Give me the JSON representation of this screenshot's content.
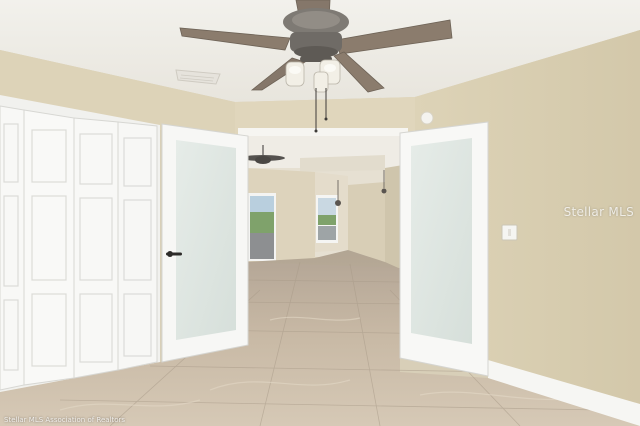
{
  "photo": {
    "subject": "empty bedroom with bifold closet doors, open frosted-glass french doors and a ceiling fan",
    "watermark_logo": "Stellar MLS",
    "watermark_credit": "Stellar MLS Association of Realtors"
  },
  "colors": {
    "wall": "#ddd3b8",
    "ceiling": "#f1efea",
    "trim": "#f7f7f4",
    "floor": "#cbbba6",
    "frosted_glass": "#e0e7e3",
    "fan_blade": "#8a7b6c",
    "fan_metal": "#7a7670"
  },
  "icons": [
    "ceiling-fan-icon",
    "door-handle-icon",
    "light-switch-icon"
  ]
}
